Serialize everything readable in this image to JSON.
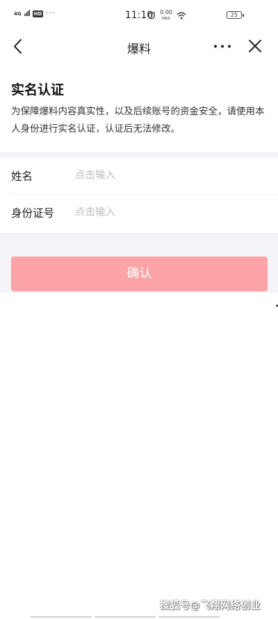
{
  "status_bar": {
    "network": "4G",
    "hd": "HD",
    "more_dots": "···",
    "time": "11:10",
    "net_speed_value": "0.00",
    "net_speed_unit": "KB/S",
    "battery": "25"
  },
  "nav": {
    "title": "爆料",
    "back_icon": "chevron-left-icon",
    "more_icon": "more-horizontal-icon",
    "close_icon": "close-icon"
  },
  "intro": {
    "title": "实名认证",
    "description": "为保障爆料内容真实性，以及后续账号的资金安全，请使用本人身份进行实名认证，认证后无法修改。"
  },
  "form": {
    "name_label": "姓名",
    "name_placeholder": "点击输入",
    "name_value": "",
    "id_label": "身份证号",
    "id_placeholder": "点击输入",
    "id_value": ""
  },
  "confirm_label": "确认",
  "watermark": "搜狐号@飞翔网络创业",
  "colors": {
    "button_bg": "#fba3a7",
    "page_gray": "#f4f4f8",
    "placeholder": "#bdbdbd"
  }
}
